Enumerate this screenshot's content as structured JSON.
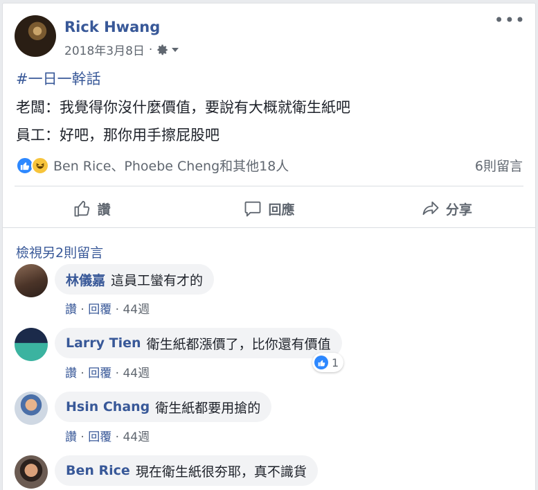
{
  "post": {
    "author": "Rick Hwang",
    "date": "2018年3月8日",
    "date_separator": "·",
    "hashtag": "#一日一幹話",
    "lines": [
      "老闆：我覺得你沒什麼價值，要說有大概就衛生紙吧",
      "員工：好吧，那你用手擦屁股吧"
    ],
    "reactions_text": "Ben Rice、Phoebe Cheng和其他18人",
    "comment_count": "6則留言",
    "reaction_icons": [
      "like-icon",
      "haha-icon"
    ]
  },
  "actions": {
    "like": "讚",
    "comment": "回應",
    "share": "分享"
  },
  "view_more": "檢視另2則留言",
  "meta": {
    "like": "讚",
    "reply": "回覆",
    "sep": " · "
  },
  "comments": [
    {
      "name": "林儀嘉",
      "text": "這員工蠻有才的",
      "time": "44週"
    },
    {
      "name": "Larry Tien",
      "text": "衛生紙都漲價了，比你還有價值",
      "time": "44週",
      "likes": "1"
    },
    {
      "name": "Hsin Chang",
      "text": "衛生紙都要用搶的",
      "time": "44週"
    },
    {
      "name": "Ben Rice",
      "text": "現在衛生紙很夯耶，真不識貨",
      "time": ""
    }
  ],
  "colors": {
    "link": "#385898",
    "secondary_text": "#606770",
    "like_blue": "#2d88ff",
    "haha_yellow": "#f7c43b",
    "bubble_bg": "#f2f3f5"
  }
}
